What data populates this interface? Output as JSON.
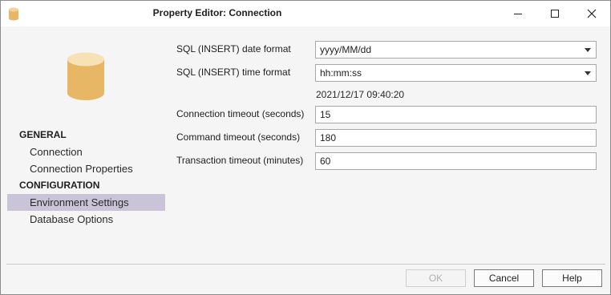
{
  "window": {
    "title": "Property Editor:  Connection",
    "icon": "database-icon",
    "controls": {
      "minimize": "minimize-icon",
      "maximize": "maximize-icon",
      "close": "close-icon"
    }
  },
  "sidebar": {
    "logo": "database-icon",
    "accent_color": "#e8b765",
    "sections": [
      {
        "header": "GENERAL",
        "items": [
          "Connection",
          "Connection Properties"
        ]
      },
      {
        "header": "CONFIGURATION",
        "items": [
          "Environment Settings",
          "Database Options"
        ]
      }
    ],
    "active_item": "Environment Settings",
    "active_color": "#c9c4d8"
  },
  "form": {
    "date_format_label": "SQL (INSERT) date format",
    "date_format_value": "yyyy/MM/dd",
    "time_format_label": "SQL (INSERT) time format",
    "time_format_value": "hh:mm:ss",
    "preview": "2021/12/17 09:40:20",
    "connection_timeout_label": "Connection timeout (seconds)",
    "connection_timeout_value": "15",
    "command_timeout_label": "Command timeout (seconds)",
    "command_timeout_value": "180",
    "transaction_timeout_label": "Transaction timeout (minutes)",
    "transaction_timeout_value": "60"
  },
  "buttons": {
    "ok": "OK",
    "cancel": "Cancel",
    "help": "Help"
  }
}
